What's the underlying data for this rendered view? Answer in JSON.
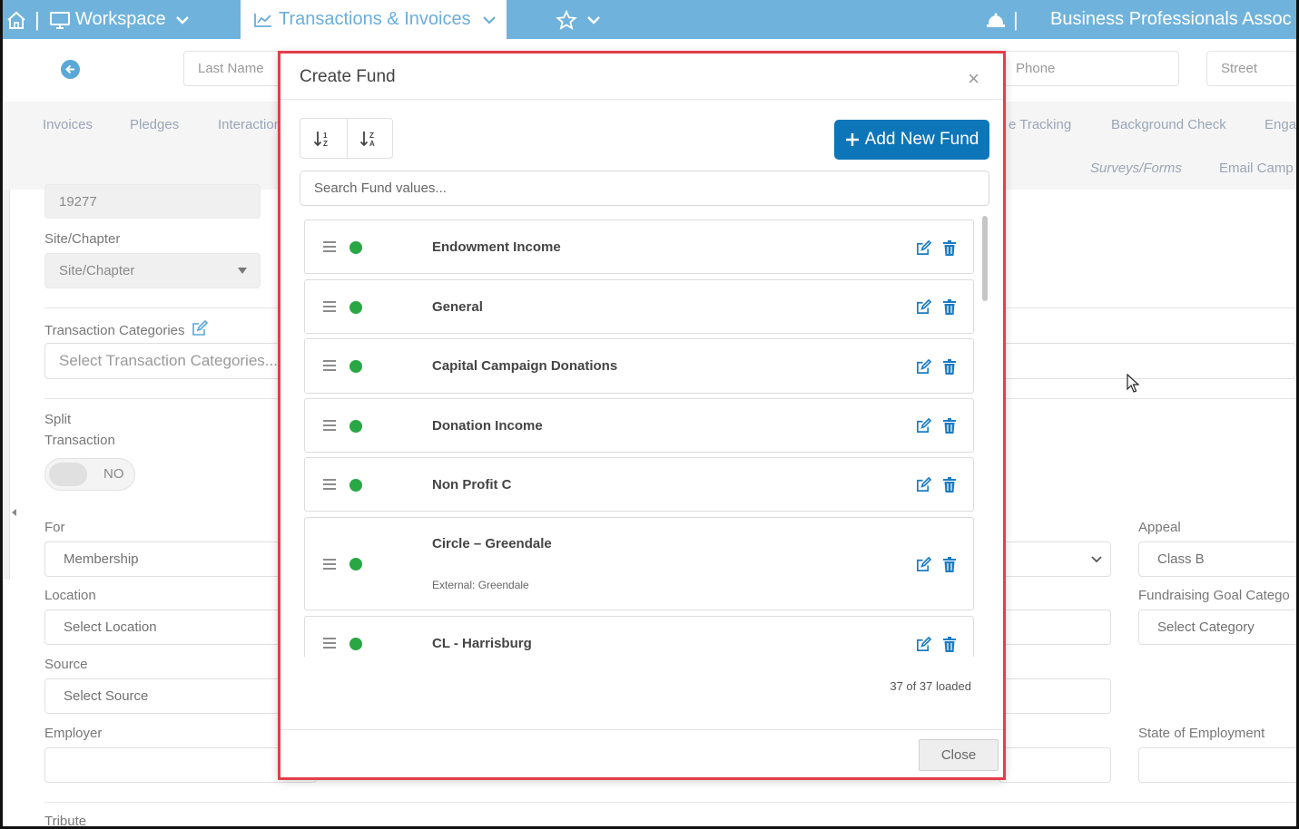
{
  "topbar": {
    "workspace_label": "Workspace",
    "transactions_label": "Transactions & Invoices",
    "org_name": "Business Professionals Assoc",
    "separator": "|"
  },
  "search_row": {
    "last_name_placeholder": "Last Name",
    "phone_placeholder": "Phone",
    "street_placeholder": "Street"
  },
  "subnav": {
    "tabs": [
      "Invoices",
      "Pledges",
      "Interaction",
      "e Tracking",
      "Background Check",
      "Enga"
    ],
    "row2": [
      "Surveys/Forms",
      "Email Camp"
    ]
  },
  "form": {
    "id_value": "19277",
    "site_label": "Site/Chapter",
    "site_placeholder": "Site/Chapter",
    "categories_label": "Transaction Categories",
    "categories_placeholder": "Select Transaction Categories...",
    "split_label_1": "Split",
    "split_label_2": "Transaction",
    "split_toggle": "NO",
    "for_label": "For",
    "for_value": "Membership",
    "appeal_label": "Appeal",
    "appeal_value": "Class B",
    "location_label": "Location",
    "location_placeholder": "Select Location",
    "goal_label": "Fundraising Goal Catego",
    "goal_placeholder": "Select Category",
    "source_label": "Source",
    "source_placeholder": "Select Source",
    "employer_label": "Employer",
    "state_label": "State of Employment",
    "tribute_label": "Tribute"
  },
  "modal": {
    "title": "Create Fund",
    "close_x": "×",
    "add_button": "Add New Fund",
    "search_placeholder": "Search Fund values...",
    "loaded_text": "37 of 37 loaded",
    "close_button": "Close",
    "status_color": "#29a745",
    "accent": "#0d76b8",
    "funds": [
      {
        "name": "Endowment Income",
        "external": ""
      },
      {
        "name": "General",
        "external": ""
      },
      {
        "name": "Capital Campaign Donations",
        "external": ""
      },
      {
        "name": "Donation Income",
        "external": ""
      },
      {
        "name": "Non Profit C",
        "external": ""
      },
      {
        "name": "Circle – Greendale",
        "external": "External: Greendale"
      },
      {
        "name": "CL - Harrisburg",
        "external": ""
      }
    ]
  }
}
